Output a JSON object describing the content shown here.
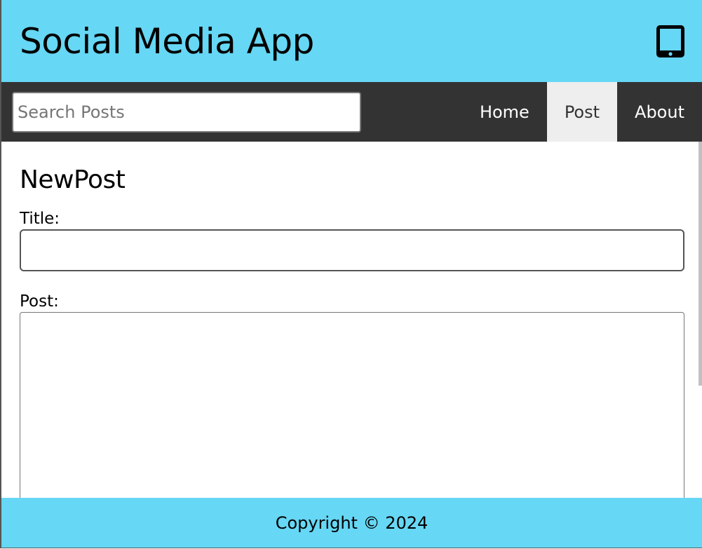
{
  "header": {
    "title": "Social Media App",
    "icon": "tablet-icon"
  },
  "nav": {
    "search_placeholder": "Search Posts",
    "links": [
      {
        "label": "Home",
        "active": false
      },
      {
        "label": "Post",
        "active": true
      },
      {
        "label": "About",
        "active": false
      }
    ]
  },
  "main": {
    "heading": "NewPost",
    "title_label": "Title:",
    "title_value": "",
    "post_label": "Post:",
    "post_value": ""
  },
  "footer": {
    "copyright": "Copyright © 2024"
  },
  "colors": {
    "header_bg": "#66d7f4",
    "nav_bg": "#333333",
    "active_tab_bg": "#eeeeee"
  }
}
